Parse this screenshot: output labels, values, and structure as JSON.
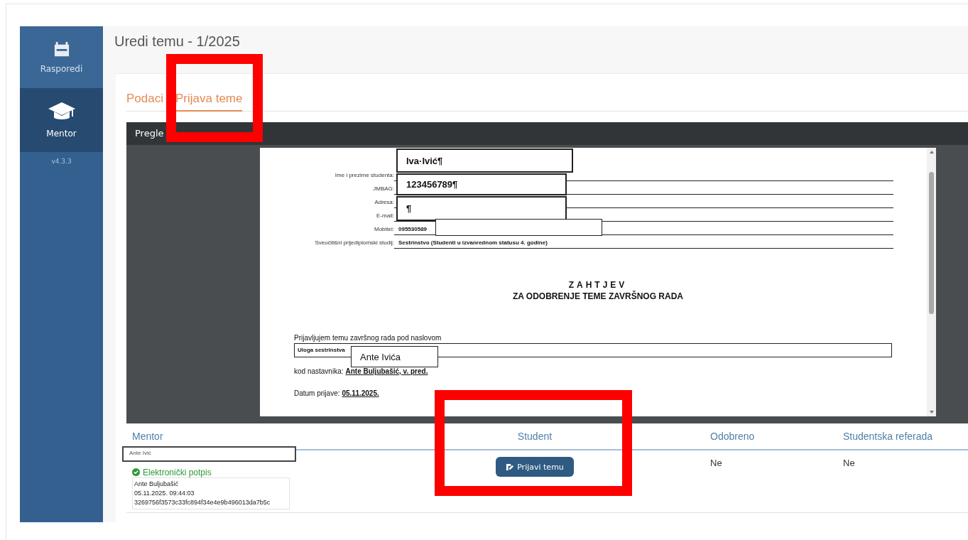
{
  "sidebar": {
    "items": [
      {
        "label": "Rasporedi",
        "selected": false
      },
      {
        "label": "Mentor",
        "selected": true
      }
    ],
    "version": "v4.3.3"
  },
  "page": {
    "title": "Uredi temu - 1/2025"
  },
  "tabs": [
    {
      "label": "Podaci",
      "selected": false
    },
    {
      "label": "Prijava teme",
      "selected": true
    }
  ],
  "preview": {
    "header": "Pregle",
    "document": {
      "fields": [
        {
          "label": "Ime i prezime studenta:"
        },
        {
          "label": "JMBAG:"
        },
        {
          "label": "Adresa:"
        },
        {
          "label": "E-mail:"
        },
        {
          "label": "Mobitel:",
          "value": "095530589"
        },
        {
          "label": "Sveučilišni prijediplomski studij:",
          "value": "Sestrinstvo (Studenti u izvanrednom statusu 4. godine)"
        }
      ],
      "heading": "ZAHTJEV",
      "subheading": "ZA ODOBRENJE TEME ZAVRŠNOG RADA",
      "intro": "Prijavljujem temu završnog rada pod naslovom",
      "topic": "Uloga sestrinstva",
      "teacher_label": "kod nastavnika:",
      "teacher": "Ante Buljubašić, v. pred.",
      "date_label": "Datum prijave:",
      "date": "05.11.2025.",
      "overlay_boxes": [
        {
          "text": "Iva·Ivić¶"
        },
        {
          "text": "123456789¶"
        },
        {
          "text": "¶"
        },
        {
          "kind": "blank"
        },
        {
          "text": "Ante Ivića"
        }
      ]
    }
  },
  "table": {
    "columns": [
      "Mentor",
      "Student",
      "Odobreno",
      "Studentska referada"
    ],
    "row": {
      "mentor": {
        "overlay": "Ante Ivić",
        "signature_label": "Elektronički potpis",
        "signature_lines": [
          "Ante Buljubašić",
          "05.11.2025. 09:44:03",
          "3269756f3573c33fc894f34e4e9b496013da7b5c"
        ]
      },
      "student_button": "Prijavi temu",
      "approved": "Ne",
      "office": "Ne"
    }
  },
  "highlight_boxes": [
    {
      "kind": "rectangle"
    },
    {
      "kind": "rectangle"
    }
  ]
}
